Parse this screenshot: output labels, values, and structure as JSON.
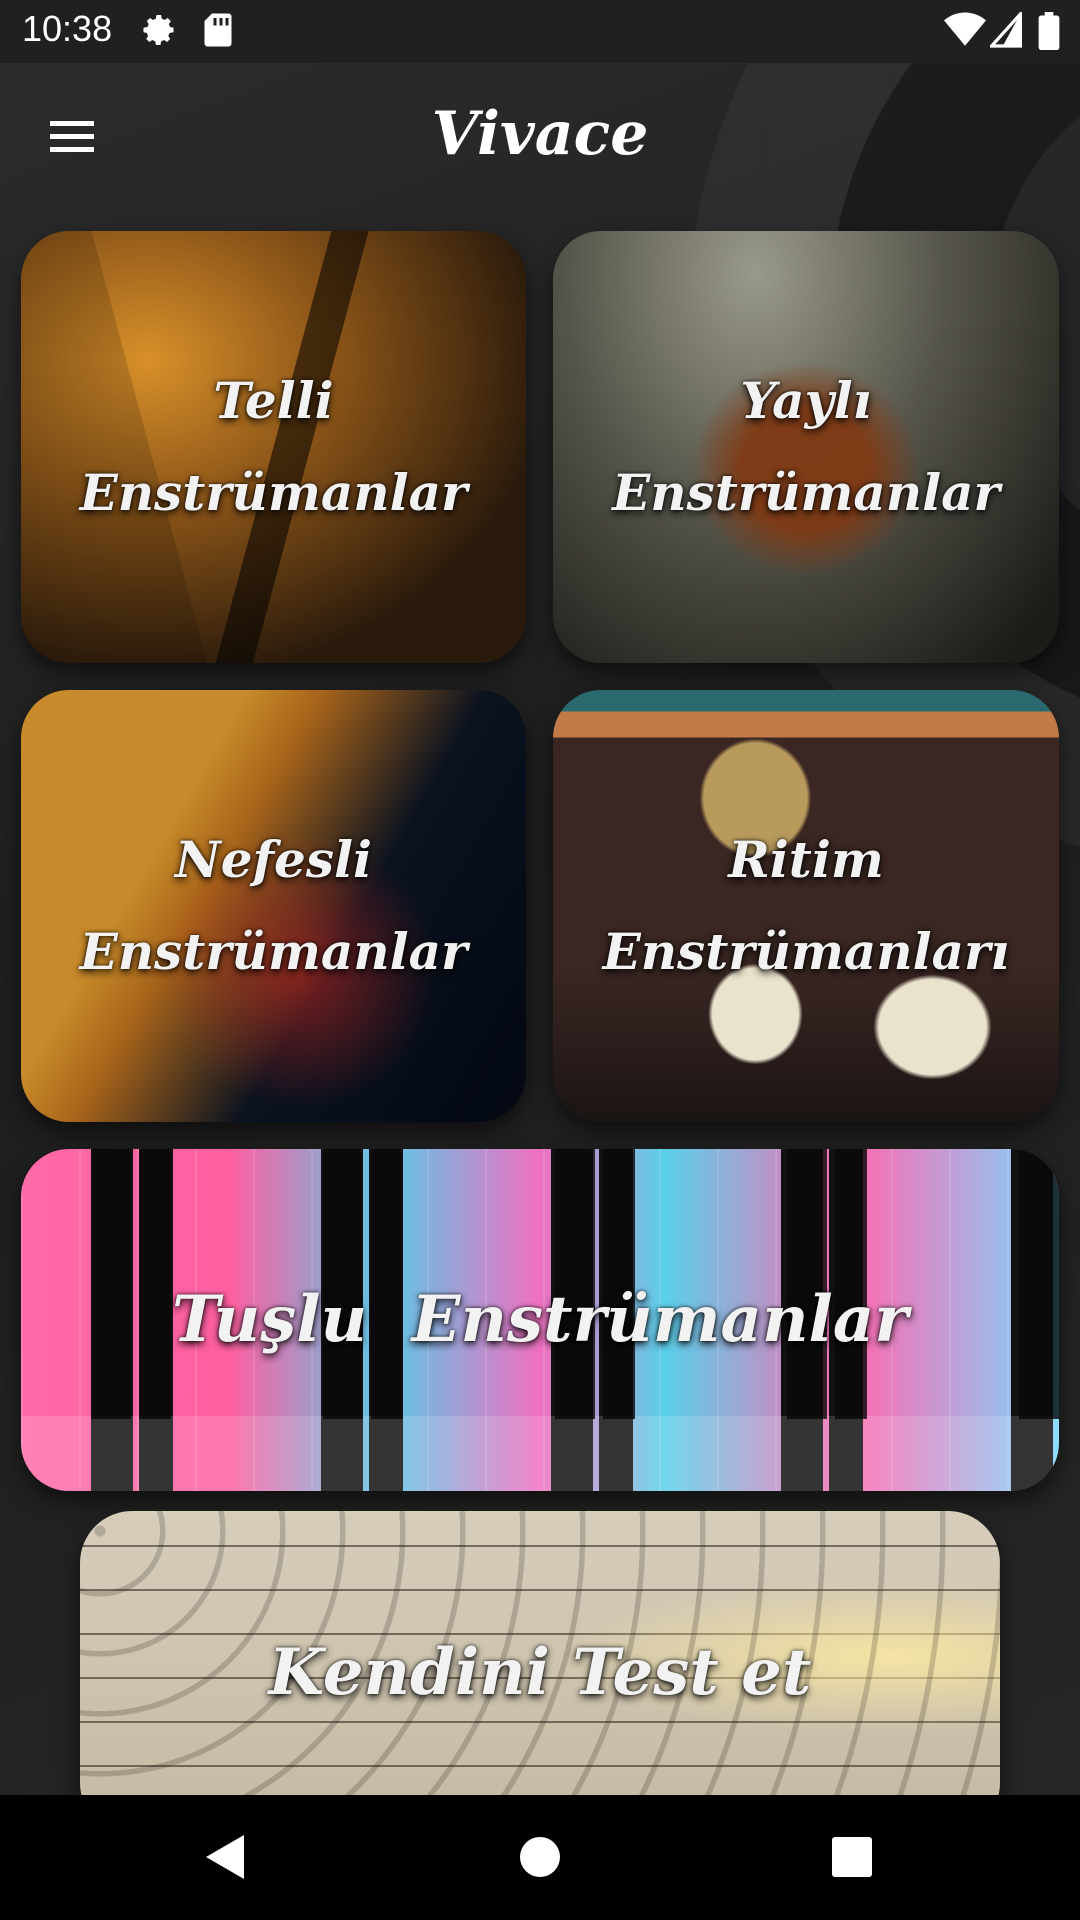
{
  "status_bar": {
    "time": "10:38",
    "icons": [
      "gear-icon",
      "sd-card-icon",
      "wifi-icon",
      "signal-icon",
      "battery-icon"
    ]
  },
  "toolbar": {
    "title": "Vivace",
    "menu_icon": "hamburger-menu-icon"
  },
  "categories": [
    {
      "line1": "Telli",
      "line2": "Enstrümanlar"
    },
    {
      "line1": "Yaylı",
      "line2": "Enstrümanlar"
    },
    {
      "line1": "Nefesli",
      "line2": "Enstrümanlar"
    },
    {
      "line1": "Ritim",
      "line2": "Enstrümanları"
    }
  ],
  "keyboard_tile": {
    "label": "Tuşlu  Enstrümanlar"
  },
  "test_tile": {
    "label": "Kendini Test et"
  },
  "nav_bar": {
    "icons": [
      "back-icon",
      "home-icon",
      "recents-icon"
    ]
  },
  "colors": {
    "background": "#1e1e1e",
    "label_text": "#f2f2f2",
    "status_bar": "#202020",
    "nav_bar": "#000000"
  }
}
